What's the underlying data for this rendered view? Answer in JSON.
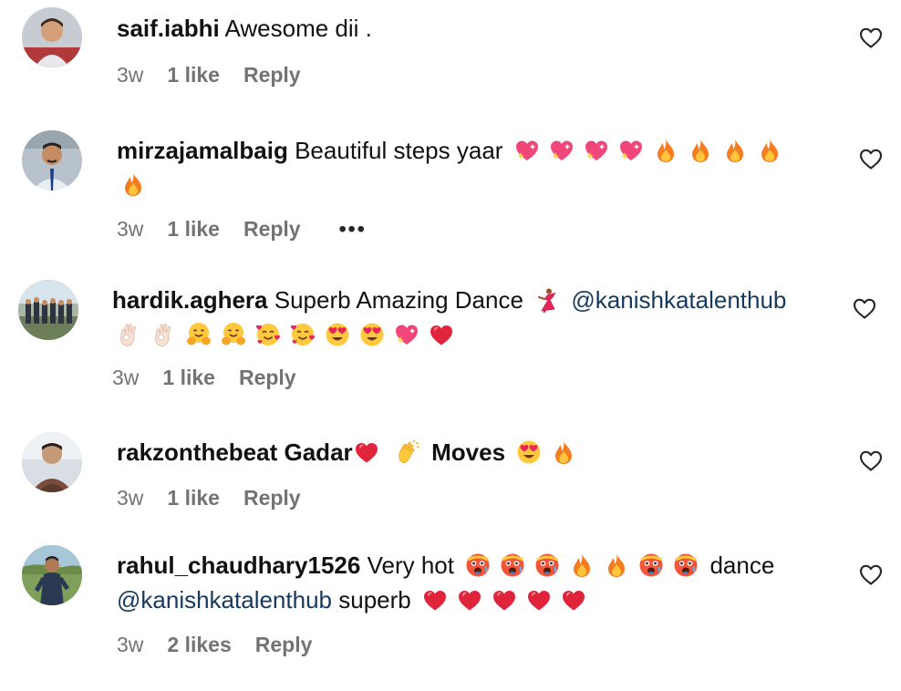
{
  "colors": {
    "text": "#111111",
    "meta": "#737373",
    "mention": "#17395f",
    "background": "#ffffff"
  },
  "comments": [
    {
      "username": "saif.iabhi",
      "text": "Awesome dii .",
      "age": "3w",
      "likes": "1 like",
      "reply": "Reply"
    },
    {
      "username": "mirzajamalbaig",
      "text": "Beautiful steps yaar",
      "emojis": [
        "sparkling-heart",
        "sparkling-heart",
        "sparkling-heart",
        "sparkling-heart",
        "fire",
        "fire",
        "fire",
        "fire",
        "fire"
      ],
      "age": "3w",
      "likes": "1 like",
      "reply": "Reply",
      "more": "•••"
    },
    {
      "username": "hardik.aghera",
      "text": "Superb Amazing Dance",
      "mention": "@kanishkatalenthub",
      "emojis": [
        "woman-dancing",
        "ok-hand",
        "ok-hand",
        "hugging-face",
        "hugging-face",
        "smiling-face-with-hearts",
        "smiling-face-with-hearts",
        "heart-eyes",
        "heart-eyes",
        "sparkling-heart",
        "red-heart"
      ],
      "age": "3w",
      "likes": "1 like",
      "reply": "Reply"
    },
    {
      "username": "rakzonthebeat",
      "text_bold_1": "Gadar",
      "text_bold_2": "Moves",
      "emojis": [
        "red-heart",
        "clapping-hands",
        "heart-eyes",
        "fire"
      ],
      "age": "3w",
      "likes": "1 like",
      "reply": "Reply"
    },
    {
      "username": "rahul_chaudhary1526",
      "text": "Very hot",
      "text_2": "dance",
      "mention": "@kanishkatalenthub",
      "text_3": "superb",
      "emojis": [
        "hot-face",
        "hot-face",
        "hot-face",
        "fire",
        "fire",
        "hot-face",
        "hot-face",
        "red-heart",
        "red-heart",
        "red-heart",
        "red-heart",
        "red-heart"
      ],
      "age": "3w",
      "likes": "2 likes",
      "reply": "Reply"
    }
  ]
}
